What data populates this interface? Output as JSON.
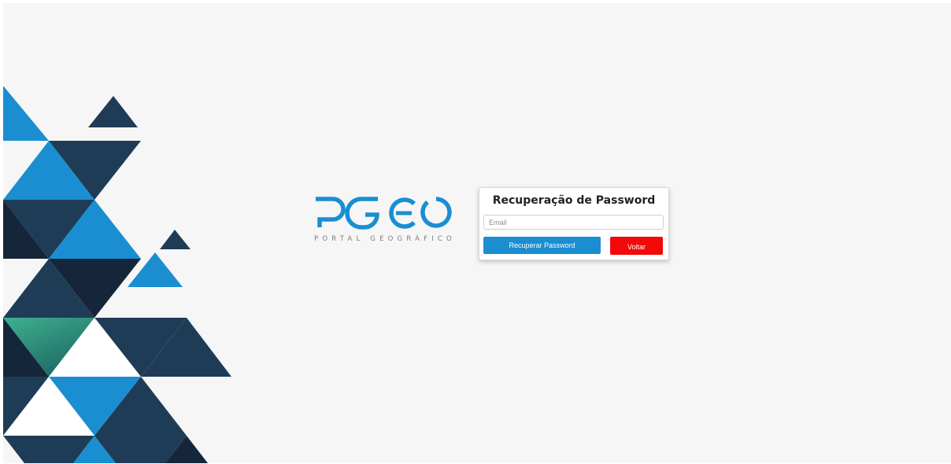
{
  "brand": {
    "logo_text": "PGEO",
    "subtitle": "PORTAL GEOGRÁFICO",
    "logo_color": "#1b8ed1"
  },
  "recover_form": {
    "title": "Recuperação de Password",
    "email_placeholder": "Email",
    "email_value": "",
    "submit_label": "Recuperar Password",
    "back_label": "Voltar"
  },
  "colors": {
    "primary_blue": "#1b8ed1",
    "dark_navy": "#1f3c57",
    "deep_navy": "#15263a",
    "teal": "#3aa88a",
    "danger_red": "#f20a0a",
    "background": "#f6f6f6"
  }
}
